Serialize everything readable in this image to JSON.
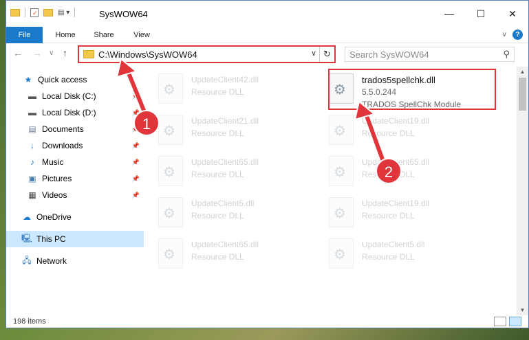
{
  "titlebar": {
    "title": "SysWOW64",
    "controls": {
      "minimize": "—",
      "maximize": "☐",
      "close": "✕"
    }
  },
  "ribbon": {
    "tabs": [
      "File",
      "Home",
      "Share",
      "View"
    ]
  },
  "address": {
    "path": "C:\\Windows\\SysWOW64",
    "search_placeholder": "Search SysWOW64"
  },
  "sidebar": {
    "items": [
      {
        "label": "Quick access",
        "icon": "star-icon",
        "pinned": false
      },
      {
        "label": "Local Disk (C:)",
        "icon": "drive-icon",
        "pinned": true
      },
      {
        "label": "Local Disk (D:)",
        "icon": "drive-icon",
        "pinned": true
      },
      {
        "label": "Documents",
        "icon": "documents-icon",
        "pinned": true
      },
      {
        "label": "Downloads",
        "icon": "download-icon",
        "pinned": true
      },
      {
        "label": "Music",
        "icon": "music-icon",
        "pinned": true
      },
      {
        "label": "Pictures",
        "icon": "pictures-icon",
        "pinned": true
      },
      {
        "label": "Videos",
        "icon": "videos-icon",
        "pinned": true
      },
      {
        "label": "OneDrive",
        "icon": "cloud-icon",
        "pinned": false
      },
      {
        "label": "This PC",
        "icon": "computer-icon",
        "pinned": false,
        "selected": true
      },
      {
        "label": "Network",
        "icon": "network-icon",
        "pinned": false
      }
    ]
  },
  "files": {
    "highlighted": {
      "name": "trados5spellchk.dll",
      "version": "5.5.0.244",
      "description": "TRADOS SpellChk Module"
    },
    "faded": [
      {
        "name": "UpdateClient42.dll",
        "desc": "Resource DLL"
      },
      {
        "name": "UpdateClient21.dll",
        "desc": "Resource DLL"
      },
      {
        "name": "UpdateClient19.dll",
        "desc": "Resource DLL"
      },
      {
        "name": "UpdateClient65.dll",
        "desc": "Resource DLL"
      },
      {
        "name": "UpdateClient65.dll",
        "desc": "Resource DLL"
      },
      {
        "name": "UpdateClient5.dll",
        "desc": "Resource DLL"
      },
      {
        "name": "UpdateClient19.dll",
        "desc": "Resource DLL"
      },
      {
        "name": "UpdateClient65.dll",
        "desc": "Resource DLL"
      },
      {
        "name": "UpdateClient5.dll",
        "desc": "Resource DLL"
      }
    ]
  },
  "status": {
    "count": "198 items"
  },
  "annotations": {
    "badge1": "1",
    "badge2": "2",
    "color": "#e0353a"
  }
}
